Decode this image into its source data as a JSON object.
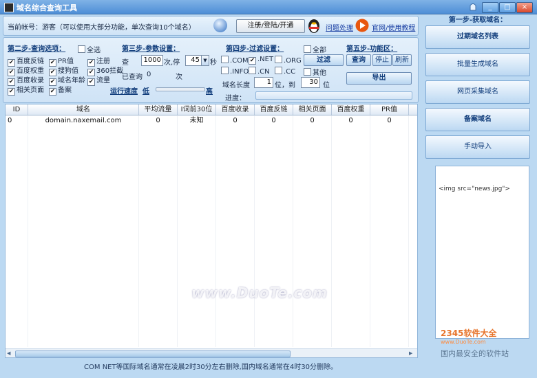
{
  "window": {
    "title": "域名综合查询工具",
    "buttons": [
      "_",
      "□",
      "×"
    ]
  },
  "infobar": {
    "account_text": "当前帐号：游客（可以使用大部分功能，单次查询10个域名）",
    "register_button": "注册/登陆/开通",
    "help_link": "问题处理",
    "tutorial_link": "官网/使用教程"
  },
  "step2": {
    "title": "第二步-查询选项：",
    "select_all": "全选",
    "options": [
      {
        "label": "百度反链",
        "checked": true
      },
      {
        "label": "百度权重",
        "checked": true
      },
      {
        "label": "百度收录",
        "checked": true
      },
      {
        "label": "相关页面",
        "checked": true
      },
      {
        "label": "PR值",
        "checked": true
      },
      {
        "label": "搜狗值",
        "checked": true
      },
      {
        "label": "域名年龄",
        "checked": true
      },
      {
        "label": "备案",
        "checked": true
      },
      {
        "label": "注册",
        "checked": true
      },
      {
        "label": "360拦截",
        "checked": true
      },
      {
        "label": "流量",
        "checked": true
      }
    ]
  },
  "step3": {
    "title": "第三步-参数设置：",
    "query_label": "查",
    "count_value": "1000",
    "times_label": "次,停",
    "pause_value": "45",
    "seconds_label": "秒",
    "queried_label": "已查询",
    "queried_value": "0",
    "queried_unit": "次",
    "speed_label": "运行速度",
    "speed_low": "低",
    "speed_high": "高"
  },
  "step4": {
    "title": "第四步-过滤设置：",
    "all_label": "全部",
    "tlds": [
      {
        "label": ".COM",
        "checked": false
      },
      {
        "label": ".NET",
        "checked": true
      },
      {
        "label": ".ORG",
        "checked": false
      },
      {
        "label": ".INFO",
        "checked": false
      },
      {
        "label": ".CN",
        "checked": false
      },
      {
        "label": ".CC",
        "checked": false
      },
      {
        "label": "其他",
        "checked": false
      }
    ],
    "filter_button": "过滤",
    "length_label": "域名长度",
    "length_from": "1",
    "length_to_label": "位，到",
    "length_to": "30",
    "length_unit": "位",
    "progress_label": "进度："
  },
  "step5": {
    "title": "第五步-功能区：",
    "query_button": "查询",
    "stop_button": "停止",
    "refresh_button": "刷新",
    "export_button": "导出"
  },
  "table": {
    "columns": [
      "ID",
      "域名",
      "平均流量",
      "I词前30位",
      "百度收录",
      "百度反链",
      "相关页面",
      "百度权重",
      "PR值"
    ],
    "rows": [
      [
        "0",
        "domain.naxemail.com",
        "0",
        "未知",
        "0",
        "0",
        "0",
        "0",
        "0"
      ]
    ]
  },
  "status": "COM NET等国际域名通常在凌晨2时30分左右删除,国内域名通常在4时30分删除。",
  "right": {
    "title": "第一步-获取域名：",
    "buttons": [
      "过期域名列表",
      "批量生成域名",
      "网页采集域名",
      "备案域名",
      "手动导入"
    ],
    "news_text": "<img src=\"news.jpg\">"
  },
  "watermark": "www.DuoTe.com",
  "logo": {
    "brand": "2345软件大全",
    "site": "www.DuoTe.com",
    "slogan": "国内最安全的软件站"
  }
}
